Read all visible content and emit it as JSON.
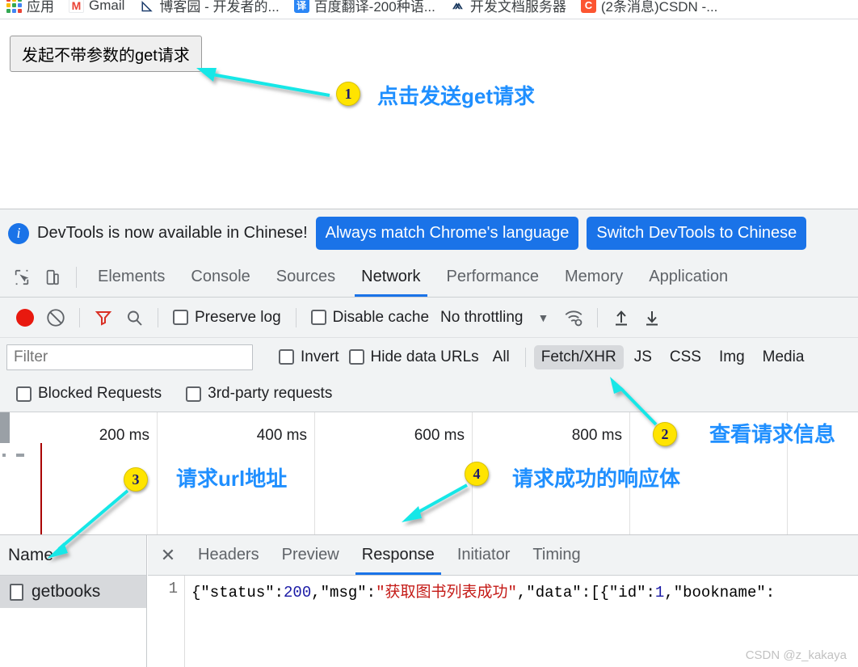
{
  "bookmarks": [
    {
      "label": "应用",
      "icon": "apps-grid-icon"
    },
    {
      "label": "Gmail",
      "icon": "gmail-icon"
    },
    {
      "label": "博客园 - 开发者的...",
      "icon": "cnblogs-icon"
    },
    {
      "label": "百度翻译-200种语...",
      "icon": "baidu-fanyi-icon"
    },
    {
      "label": "开发文档服务器",
      "icon": "doc-server-icon"
    },
    {
      "label": "(2条消息)CSDN -...",
      "icon": "csdn-icon"
    }
  ],
  "page": {
    "get_button_label": "发起不带参数的get请求"
  },
  "devtools_banner": {
    "message": "DevTools is now available in Chinese!",
    "primary_button": "Always match Chrome's language",
    "secondary_button": "Switch DevTools to Chinese"
  },
  "devtools_tabs": [
    {
      "label": "Elements",
      "active": false
    },
    {
      "label": "Console",
      "active": false
    },
    {
      "label": "Sources",
      "active": false
    },
    {
      "label": "Network",
      "active": true
    },
    {
      "label": "Performance",
      "active": false
    },
    {
      "label": "Memory",
      "active": false
    },
    {
      "label": "Application",
      "active": false
    }
  ],
  "network_toolbar": {
    "preserve_log": "Preserve log",
    "disable_cache": "Disable cache",
    "throttling": "No throttling"
  },
  "filter_row": {
    "placeholder": "Filter",
    "invert": "Invert",
    "hide_data_urls": "Hide data URLs",
    "types": [
      {
        "label": "All",
        "selected": false
      },
      {
        "label": "Fetch/XHR",
        "selected": true
      },
      {
        "label": "JS",
        "selected": false
      },
      {
        "label": "CSS",
        "selected": false
      },
      {
        "label": "Img",
        "selected": false
      },
      {
        "label": "Media",
        "selected": false
      }
    ]
  },
  "blocked_row": {
    "blocked_requests": "Blocked Requests",
    "third_party": "3rd-party requests"
  },
  "overview": {
    "ticks": [
      "200 ms",
      "400 ms",
      "600 ms",
      "800 ms"
    ]
  },
  "request_list": {
    "column_header": "Name",
    "rows": [
      {
        "name": "getbooks",
        "selected": true
      }
    ]
  },
  "detail_panel": {
    "tabs": [
      {
        "label": "Headers",
        "active": false
      },
      {
        "label": "Preview",
        "active": false
      },
      {
        "label": "Response",
        "active": true
      },
      {
        "label": "Initiator",
        "active": false
      },
      {
        "label": "Timing",
        "active": false
      }
    ],
    "line_number": "1",
    "response_body": {
      "p1": "{\"status\":",
      "num1": "200",
      "p2": ",\"msg\":",
      "str1": "\"获取图书列表成功\"",
      "p3": ",\"data\":[{\"id\":",
      "num2": "1",
      "p4": ",\"bookname\":"
    }
  },
  "annotations": [
    {
      "number": "1",
      "text": "点击发送get请求"
    },
    {
      "number": "2",
      "text": "查看请求信息"
    },
    {
      "number": "3",
      "text": "请求url地址"
    },
    {
      "number": "4",
      "text": "请求成功的响应体"
    }
  ],
  "watermark": "CSDN @z_kakaya",
  "colors": {
    "accent_blue": "#1a73e8",
    "annotation_blue": "#1f8fff",
    "badge_yellow": "#ffe400",
    "arrow_cyan": "#18e7e7",
    "record_red": "#e8190f",
    "json_string_red": "#c41a16",
    "json_number_blue": "#1a1aa6"
  }
}
